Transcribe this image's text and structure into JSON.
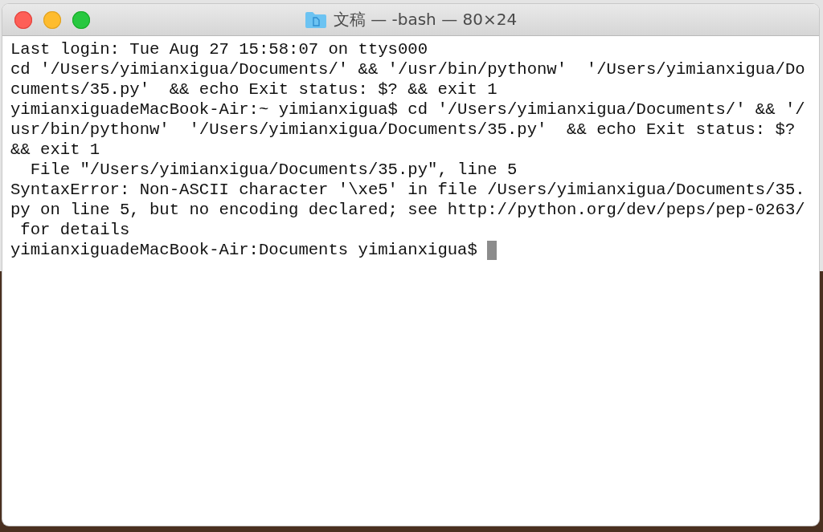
{
  "window": {
    "title": "文稿 — -bash — 80×24"
  },
  "terminal": {
    "lines": [
      "Last login: Tue Aug 27 15:58:07 on ttys000",
      "cd '/Users/yimianxigua/Documents/' && '/usr/bin/pythonw'  '/Users/yimianxigua/Do",
      "cuments/35.py'  && echo Exit status: $? && exit 1",
      "yimianxiguadeMacBook-Air:~ yimianxigua$ cd '/Users/yimianxigua/Documents/' && '/",
      "usr/bin/pythonw'  '/Users/yimianxigua/Documents/35.py'  && echo Exit status: $?",
      "&& exit 1",
      "  File \"/Users/yimianxigua/Documents/35.py\", line 5",
      "SyntaxError: Non-ASCII character '\\xe5' in file /Users/yimianxigua/Documents/35.",
      "py on line 5, but no encoding declared; see http://python.org/dev/peps/pep-0263/",
      " for details",
      "yimianxiguadeMacBook-Air:Documents yimianxigua$ "
    ]
  }
}
